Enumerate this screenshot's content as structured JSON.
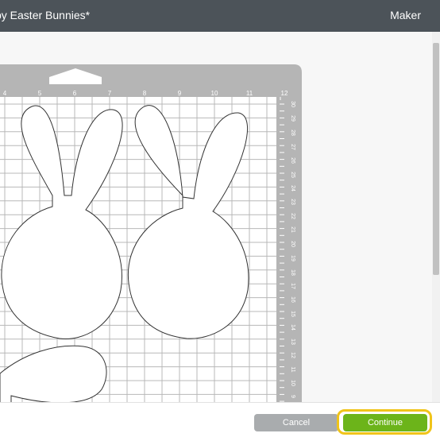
{
  "header": {
    "title": "py Easter Bunnies*",
    "machine": "Maker"
  },
  "mat": {
    "top_ruler": [
      "4",
      "5",
      "6",
      "7",
      "8",
      "9",
      "10",
      "11",
      "12"
    ],
    "right_ruler": [
      "30",
      "29",
      "28",
      "27",
      "26",
      "25",
      "24",
      "23",
      "22",
      "21",
      "20",
      "19",
      "18",
      "17",
      "16",
      "15",
      "14",
      "13",
      "12",
      "11",
      "10",
      "9"
    ],
    "shapes": [
      "bunny",
      "bunny",
      "bunny-ear"
    ]
  },
  "footer": {
    "cancel_label": "Cancel",
    "continue_label": "Continue"
  },
  "colors": {
    "header_bg": "#4c5359",
    "mat": "#b5b5b5",
    "continue": "#6cb41a",
    "cancel": "#a9acae",
    "highlight": "#f0c419"
  }
}
